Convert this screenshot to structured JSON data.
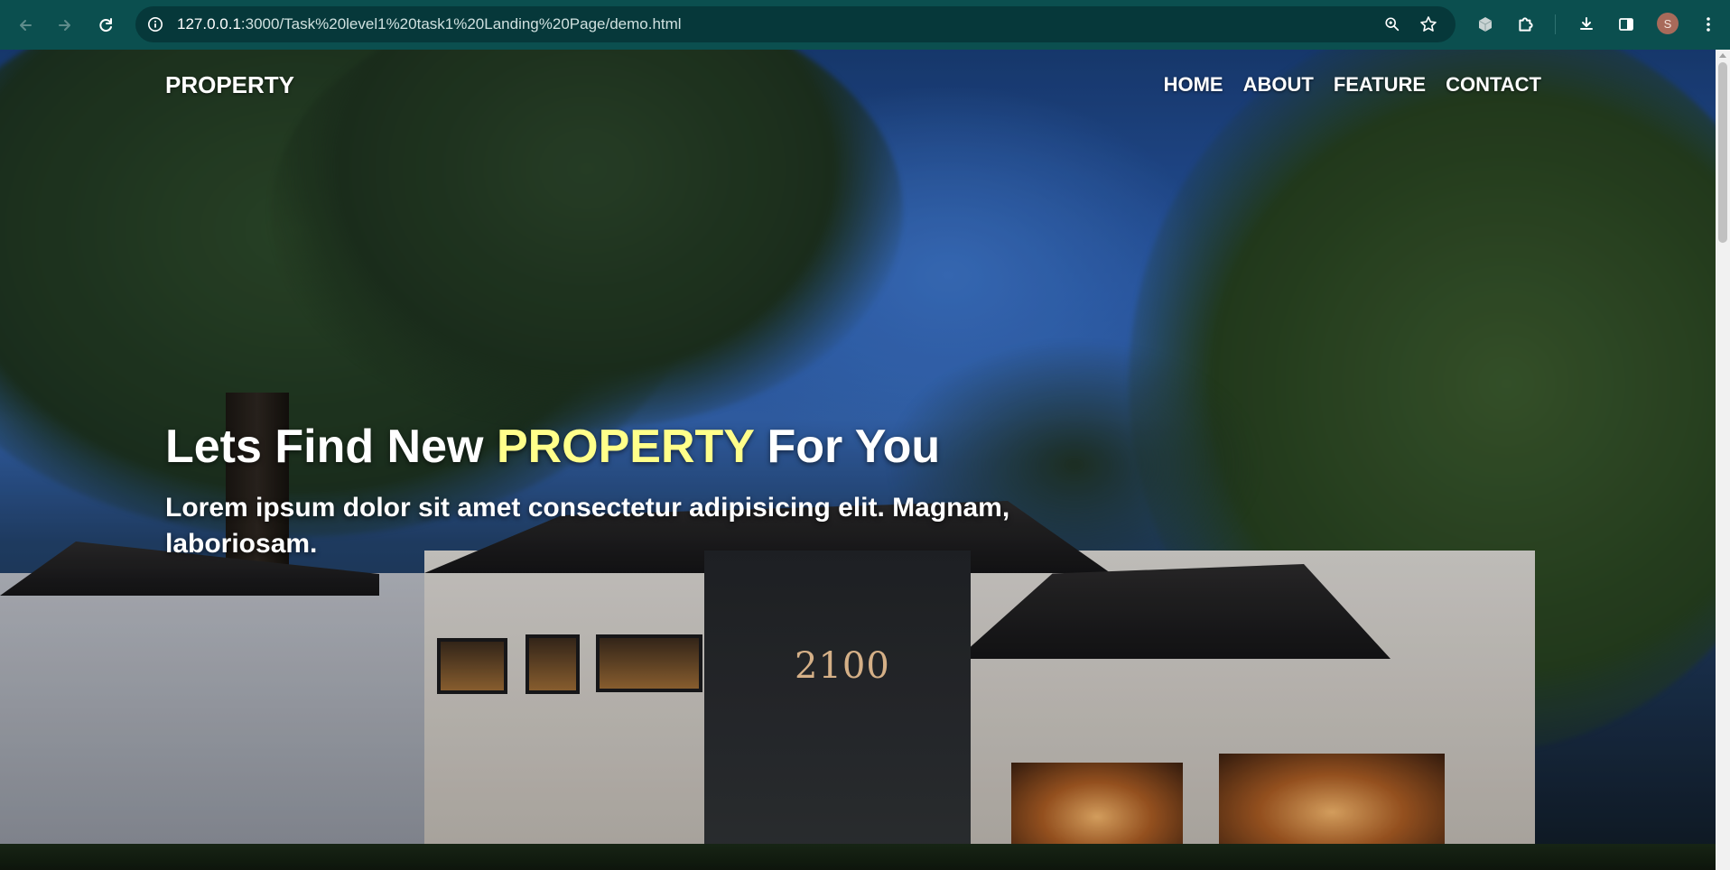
{
  "browser": {
    "url_host": "127.0.0.1",
    "url_rest": ":3000/Task%20level1%20task1%20Landing%20Page/demo.html",
    "profile_initial": "S"
  },
  "site": {
    "brand": "PROPERTY",
    "nav": [
      "HOME",
      "ABOUT",
      "FEATURE",
      "CONTACT"
    ]
  },
  "hero": {
    "title_before": "Lets Find New",
    "title_accent": "PROPERTY",
    "title_after": "For You",
    "subtitle": "Lorem ipsum dolor sit amet consectetur adipisicing elit. Magnam, laboriosam.",
    "sign_text": "2100"
  },
  "colors": {
    "chrome": "#0b4f4f",
    "accent_yellow": "#ffff8a"
  }
}
